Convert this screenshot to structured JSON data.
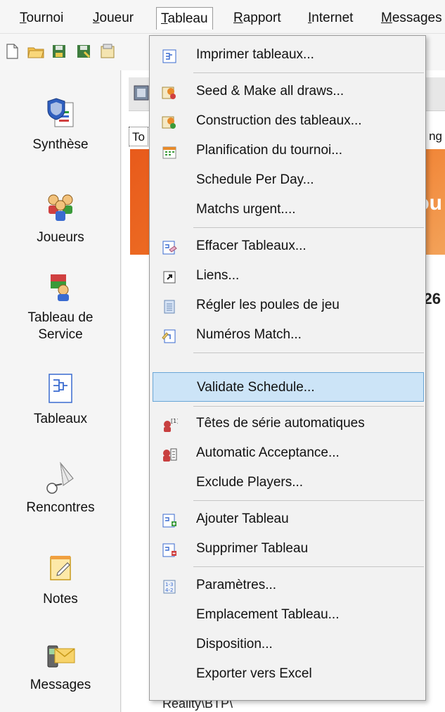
{
  "menubar": {
    "items": [
      {
        "label": "Tournoi",
        "mnemonic": "T"
      },
      {
        "label": "Joueur",
        "mnemonic": "J"
      },
      {
        "label": "Tableau",
        "mnemonic": "T"
      },
      {
        "label": "Rapport",
        "mnemonic": "R"
      },
      {
        "label": "Internet",
        "mnemonic": "I"
      },
      {
        "label": "Messages",
        "mnemonic": "M"
      }
    ]
  },
  "toolbar": {
    "buttons": [
      "new-file-icon",
      "open-folder-icon",
      "save-icon",
      "save-as-icon",
      "properties-icon"
    ]
  },
  "sidebar": {
    "items": [
      {
        "label": "Synthèse",
        "icon": "shield-document-icon"
      },
      {
        "label": "Joueurs",
        "icon": "players-icon"
      },
      {
        "label": "Tableau de Service",
        "label_line1": "Tableau de",
        "label_line2": "Service",
        "icon": "officials-icon"
      },
      {
        "label": "Tableaux",
        "icon": "draw-bracket-icon"
      },
      {
        "label": "Rencontres",
        "icon": "shuttlecock-icon"
      },
      {
        "label": "Notes",
        "icon": "notepad-icon"
      },
      {
        "label": "Messages",
        "icon": "phone-mail-icon"
      }
    ]
  },
  "content": {
    "tab_fragment": "To",
    "right_tab_fragment": "ng",
    "banner_fragment": "ou",
    "number_fragment": "26",
    "path_fragment": "Reality\\BTP\\"
  },
  "dropdown": {
    "items": [
      {
        "label": "Imprimer tableaux...",
        "icon": "print-draw-icon"
      },
      {
        "label": "Seed & Make all draws...",
        "icon": "seed-draws-icon"
      },
      {
        "label": "Construction des tableaux...",
        "icon": "build-draws-icon"
      },
      {
        "label": "Planification du tournoi...",
        "icon": "schedule-icon"
      },
      {
        "label": "Schedule Per Day...",
        "icon": ""
      },
      {
        "label": "Matchs urgent....",
        "icon": ""
      },
      {
        "label": "Effacer Tableaux...",
        "icon": "erase-draws-icon"
      },
      {
        "label": "Liens...",
        "icon": "shortcut-link-icon"
      },
      {
        "label": "Régler les poules de jeu",
        "icon": "pools-icon"
      },
      {
        "label": "Numéros Match...",
        "icon": "match-numbers-icon"
      },
      {
        "label": "Validate Schedule...",
        "icon": ""
      },
      {
        "label": "Têtes de série automatiques",
        "icon": "auto-seeding-icon"
      },
      {
        "label": "Automatic Acceptance...",
        "icon": "auto-acceptance-icon"
      },
      {
        "label": "Exclude Players...",
        "icon": ""
      },
      {
        "label": "Ajouter Tableau",
        "icon": "add-draw-icon"
      },
      {
        "label": "Supprimer Tableau",
        "icon": "delete-draw-icon"
      },
      {
        "label": "Paramètres...",
        "icon": "settings-grid-icon"
      },
      {
        "label": "Emplacement Tableau...",
        "icon": ""
      },
      {
        "label": "Disposition...",
        "icon": ""
      },
      {
        "label": "Exporter vers Excel",
        "icon": ""
      }
    ],
    "highlighted_label": "Validate Schedule..."
  },
  "colors": {
    "menu_highlight": "#cce4f7",
    "menu_highlight_border": "#6aa6d6",
    "banner_orange": "#e85a1b"
  }
}
